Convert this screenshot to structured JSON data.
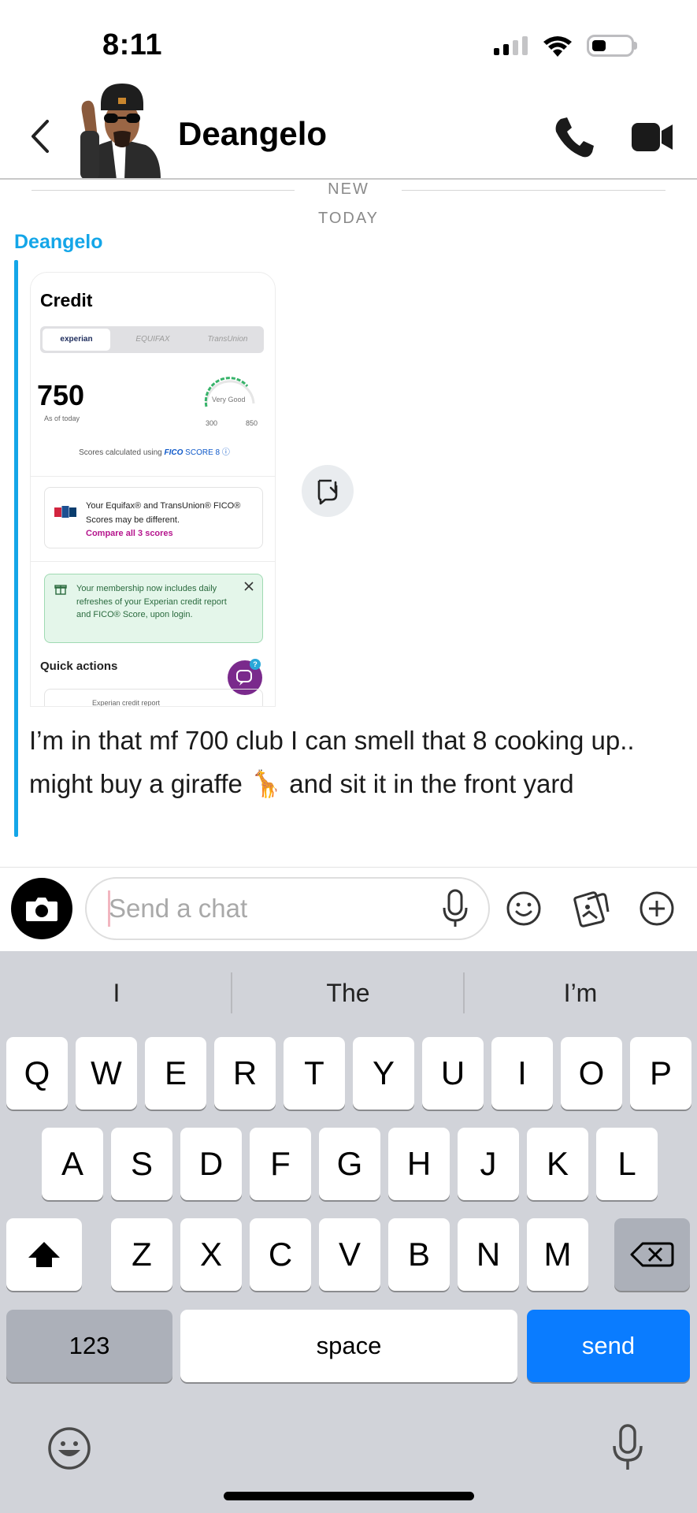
{
  "status_bar": {
    "time": "8:11"
  },
  "header": {
    "contact_name": "Deangelo"
  },
  "divider": {
    "new": "NEW",
    "today": "TODAY"
  },
  "message": {
    "sender": "Deangelo",
    "text": "I’m in that mf 700 club I can smell that 8 cooking up.. might buy a giraffe 🦒 and sit it in the front yard",
    "snapshot": {
      "title": "Credit",
      "tabs": [
        "experian",
        "EQUIFAX",
        "TransUnion"
      ],
      "score": "750",
      "as_of": "As of today",
      "rating": "Very Good",
      "range_min": "300",
      "range_max": "850",
      "fico_prefix": "Scores calculated using ",
      "fico_brand": "FICO",
      "fico_suffix": " SCORE 8 ⓘ",
      "bureau_notice": "Your Equifax® and TransUnion® FICO® Scores may be different.",
      "compare_link": "Compare all 3 scores",
      "membership_notice": "Your membership now includes daily refreshes of your Experian credit report and FICO® Score, upon login.",
      "quick_actions": "Quick actions",
      "peek_item": "Experian credit report"
    }
  },
  "input": {
    "placeholder": "Send a chat"
  },
  "keyboard": {
    "suggestions": [
      "I",
      "The",
      "I’m"
    ],
    "row1": [
      "Q",
      "W",
      "E",
      "R",
      "T",
      "Y",
      "U",
      "I",
      "O",
      "P"
    ],
    "row2": [
      "A",
      "S",
      "D",
      "F",
      "G",
      "H",
      "J",
      "K",
      "L"
    ],
    "row3": [
      "Z",
      "X",
      "C",
      "V",
      "B",
      "N",
      "M"
    ],
    "numbers_key": "123",
    "space_key": "space",
    "send_key": "send"
  },
  "colors": {
    "accent": "#14a6e8",
    "send": "#0a7cff",
    "keyboard_bg": "#d1d3d9"
  },
  "icons": [
    "back-chevron-icon",
    "phone-icon",
    "video-camera-icon",
    "camera-icon",
    "microphone-icon",
    "smiley-icon",
    "sticker-icon",
    "plus-icon",
    "save-to-chat-icon",
    "shift-icon",
    "backspace-icon"
  ]
}
